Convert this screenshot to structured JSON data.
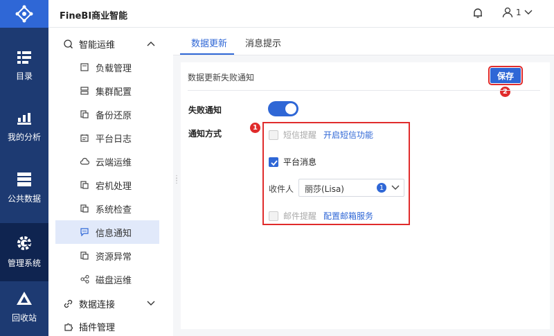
{
  "app": {
    "title": "FineBI商业智能",
    "user_label": "1"
  },
  "leftnav": [
    {
      "label": "目录",
      "icon": "catalog-icon"
    },
    {
      "label": "我的分析",
      "icon": "chart-icon"
    },
    {
      "label": "公共数据",
      "icon": "database-icon"
    },
    {
      "label": "管理系统",
      "icon": "gear-icon",
      "active": true
    },
    {
      "label": "回收站",
      "icon": "recycle-icon"
    }
  ],
  "sidebar": {
    "group_ops": {
      "label": "智能运维",
      "expanded": true
    },
    "items": [
      {
        "label": "负载管理"
      },
      {
        "label": "集群配置"
      },
      {
        "label": "备份还原"
      },
      {
        "label": "平台日志"
      },
      {
        "label": "云端运维"
      },
      {
        "label": "宕机处理"
      },
      {
        "label": "系统检查"
      },
      {
        "label": "信息通知",
        "active": true
      },
      {
        "label": "资源异常"
      },
      {
        "label": "磁盘运维"
      }
    ],
    "group_conn": {
      "label": "数据连接",
      "expanded": false
    },
    "group_plugin": {
      "label": "插件管理"
    }
  },
  "tabs": [
    {
      "label": "数据更新",
      "active": true
    },
    {
      "label": "消息提示"
    }
  ],
  "panel": {
    "section_title": "数据更新失败通知",
    "save_label": "保存",
    "fail_notify_label": "失败通知",
    "fail_notify_on": true,
    "notify_method_label": "通知方式",
    "sms": {
      "label": "短信提醒",
      "enabled": false,
      "link": "开启短信功能"
    },
    "platform": {
      "label": "平台消息",
      "checked": true
    },
    "receiver_label": "收件人",
    "receiver_value": "丽莎(Lisa)",
    "receiver_count": "1",
    "mail": {
      "label": "邮件提醒",
      "enabled": false,
      "link": "配置邮箱服务"
    }
  },
  "markers": {
    "m1": "1",
    "m2": "2"
  },
  "colors": {
    "accent": "#2f67d6",
    "nav_bg": "#1d3a72",
    "highlight": "#e02b2b"
  }
}
